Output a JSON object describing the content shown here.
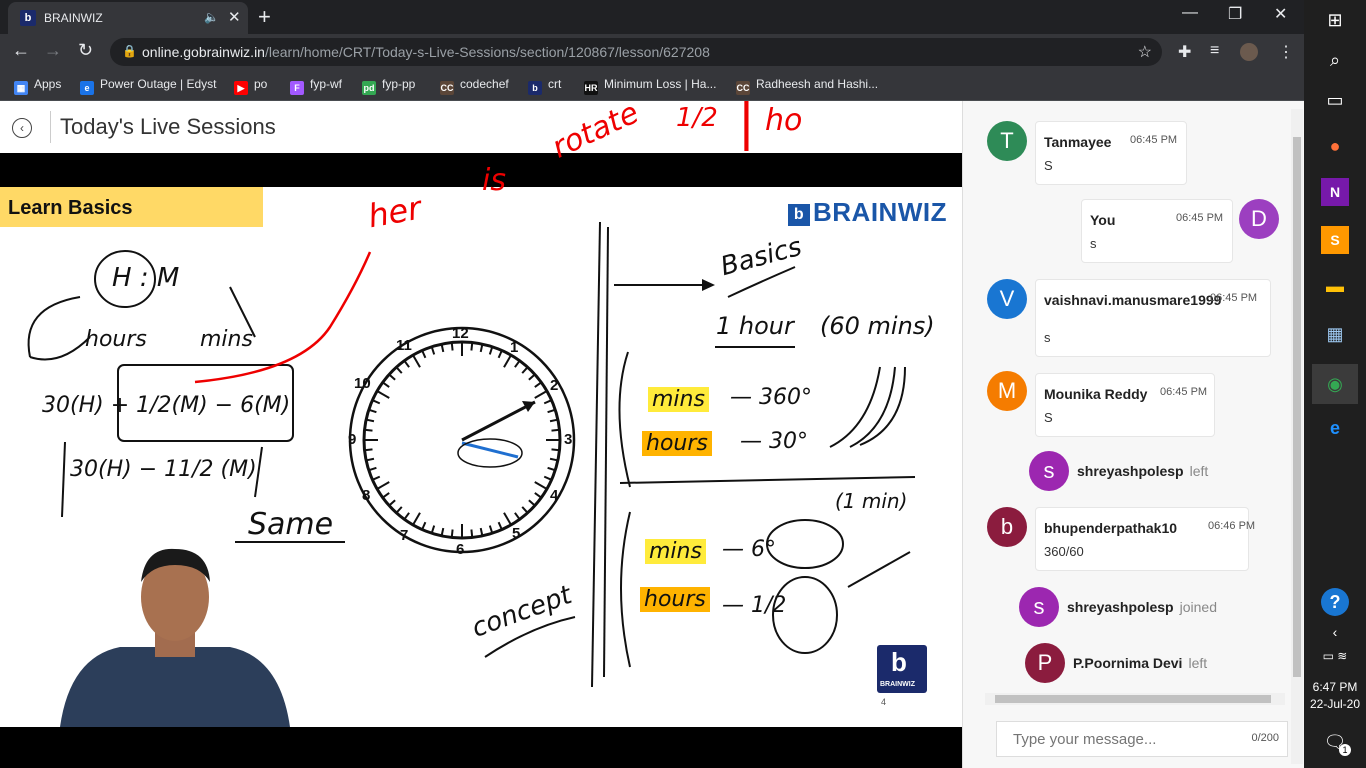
{
  "browser": {
    "tab_title": "BRAINWIZ",
    "url_host": "online.gobrainwiz.in",
    "url_path": "/learn/home/CRT/Today-s-Live-Sessions/section/120867/lesson/627208",
    "bookmarks": [
      {
        "label": "Apps",
        "color": "#4285f4",
        "glyph": "▦"
      },
      {
        "label": "Power Outage | Edyst",
        "color": "#1a73e8",
        "glyph": "e"
      },
      {
        "label": "po",
        "color": "#ff0000",
        "glyph": "▶"
      },
      {
        "label": "fyp-wf",
        "color": "#a259ff",
        "glyph": "F"
      },
      {
        "label": "fyp-pp",
        "color": "#34a853",
        "glyph": "pd"
      },
      {
        "label": "codechef",
        "color": "#5b4638",
        "glyph": "CC"
      },
      {
        "label": "crt",
        "color": "#1b2a6b",
        "glyph": "b"
      },
      {
        "label": "Minimum Loss | Ha...",
        "color": "#111111",
        "glyph": "HR"
      },
      {
        "label": "Radheesh and Hashi...",
        "color": "#5b4638",
        "glyph": "CC"
      }
    ]
  },
  "page": {
    "title": "Today's Live Sessions"
  },
  "slide": {
    "banner": "Learn Basics",
    "brand": "BRAINWIZ",
    "badge_text": "BRAINWIZ",
    "page_number": "4",
    "clock_numbers": [
      "12",
      "1",
      "2",
      "3",
      "4",
      "5",
      "6",
      "7",
      "8",
      "9",
      "10",
      "11"
    ],
    "notes": {
      "hm": "H : M",
      "hours": "hours",
      "mins": "mins",
      "formula1": "30(H) + 1/2(M) − 6(M)",
      "formula2": "30(H) − 11/2 (M)",
      "same": "Same",
      "concept": "concept",
      "basics": "Basics",
      "one_hour": "1 hour",
      "sixty": "(60 mins)",
      "mins360_a": "mins",
      "mins360_b": "— 360°",
      "hours30_a": "hours",
      "hours30_b": "— 30°",
      "one_min": "(1 min)",
      "mins6_a": "mins",
      "mins6_b": "— 6°",
      "hourshalf_a": "hours",
      "hourshalf_b": "— 1/2",
      "red_her": "her",
      "red_is": "is",
      "red_rotate": "rotate",
      "red_half": "1/2",
      "red_ho": "ho"
    }
  },
  "chat": {
    "messages": [
      {
        "name": "Tanmayee",
        "time": "06:45 PM",
        "text": "S",
        "initial": "T",
        "color": "#2e8b57"
      },
      {
        "name": "You",
        "time": "06:45 PM",
        "text": "s",
        "initial": "D",
        "color": "#9c3fc0"
      },
      {
        "name": "vaishnavi.manusmare1999",
        "time": "06:45 PM",
        "text": "s",
        "initial": "V",
        "color": "#1976d2"
      },
      {
        "name": "Mounika Reddy",
        "time": "06:45 PM",
        "text": "S",
        "initial": "M",
        "color": "#f57c00"
      },
      {
        "name": "bhupenderpathak10",
        "time": "06:46 PM",
        "text": "360/60",
        "initial": "b",
        "color": "#8b1c3e"
      }
    ],
    "events": [
      {
        "name": "shreyashpolesp",
        "status": "left",
        "initial": "s",
        "color": "#9c27b0"
      },
      {
        "name": "shreyashpolesp",
        "status": "joined",
        "initial": "s",
        "color": "#9c27b0"
      },
      {
        "name": "P.Poornima Devi",
        "status": "left",
        "initial": "P",
        "color": "#8b1c3e"
      }
    ],
    "input_placeholder": "Type your message...",
    "char_count": "0/200"
  },
  "taskbar": {
    "time": "6:47 PM",
    "date": "22-Jul-20",
    "notification_count": "1"
  }
}
